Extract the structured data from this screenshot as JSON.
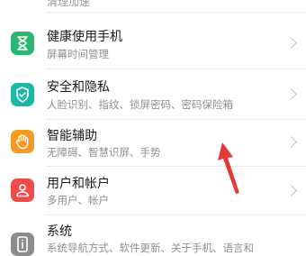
{
  "settings_list": {
    "top_partial": {
      "subtitle": "清理加速"
    },
    "items": [
      {
        "title": "健康使用手机",
        "subtitle": "屏幕时间管理",
        "icon": "hourglass-icon",
        "color": "#2bb673"
      },
      {
        "title": "安全和隐私",
        "subtitle": "人脸识别、指纹、锁屏密码、密码保险箱",
        "icon": "shield-check-icon",
        "color": "#19b9a6"
      },
      {
        "title": "智能辅助",
        "subtitle": "无障碍、智慧识屏、手势",
        "icon": "hand-icon",
        "color": "#f59a23"
      },
      {
        "title": "用户和帐户",
        "subtitle": "多用户、帐户",
        "icon": "user-icon",
        "color": "#ee4b4b"
      },
      {
        "title": "系统",
        "subtitle": "系统导航方式、软件更新、关于手机、语言和",
        "icon": "phone-info-icon",
        "color": "#8c8c8c"
      }
    ]
  },
  "annotation": {
    "arrow_color": "#e53935"
  }
}
